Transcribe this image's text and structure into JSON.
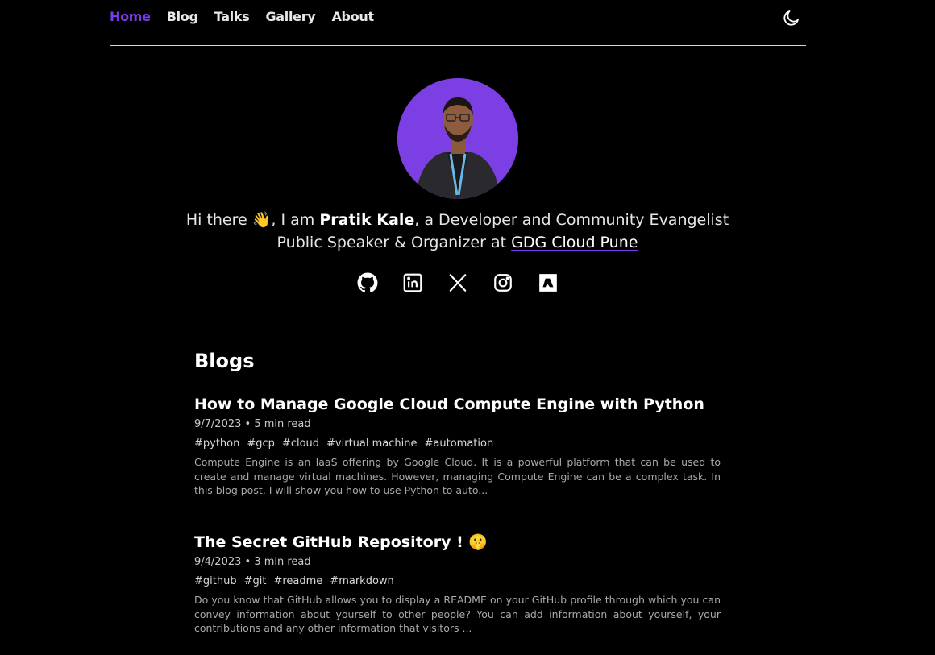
{
  "nav": {
    "items": [
      {
        "label": "Home",
        "active": true
      },
      {
        "label": "Blog"
      },
      {
        "label": "Talks"
      },
      {
        "label": "Gallery"
      },
      {
        "label": "About"
      }
    ],
    "theme_icon": "moon-icon"
  },
  "profile": {
    "greeting_prefix": "Hi there ",
    "wave_emoji": "👋",
    "greeting_mid": ", I am ",
    "name": "Pratik Kale",
    "role": ", a Developer and Community Evangelist",
    "line2_prefix": "Public Speaker & Organizer at ",
    "org_link": "GDG Cloud Pune"
  },
  "socials": [
    {
      "icon": "github-icon"
    },
    {
      "icon": "linkedin-icon"
    },
    {
      "icon": "x-twitter-icon"
    },
    {
      "icon": "instagram-icon"
    },
    {
      "icon": "hashnode-icon"
    }
  ],
  "blogs": {
    "heading": "Blogs",
    "posts": [
      {
        "title": "How to Manage Google Cloud Compute Engine with Python",
        "meta": "9/7/2023 • 5 min read",
        "tags": [
          "#python",
          "#gcp",
          "#cloud",
          "#virtual machine",
          "#automation"
        ],
        "summary": "Compute Engine is an IaaS offering by Google Cloud. It is a powerful platform that can be used to create and manage virtual machines. However, managing Compute Engine can be a complex task. In this blog post, I will show you how to use Python to auto..."
      },
      {
        "title": "The Secret GitHub Repository ! 🤫",
        "meta": "9/4/2023 • 3 min read",
        "tags": [
          "#github",
          "#git",
          "#readme",
          "#markdown"
        ],
        "summary": "Do you know that GitHub allows you to display a README on your GitHub profile through which you can convey information about yourself to other people? You can add information about yourself, your contributions and any other information that visitors ..."
      }
    ]
  },
  "colors": {
    "accent": "#7c3aed",
    "background": "#000000",
    "avatar_bg": "#7b3fe4"
  }
}
